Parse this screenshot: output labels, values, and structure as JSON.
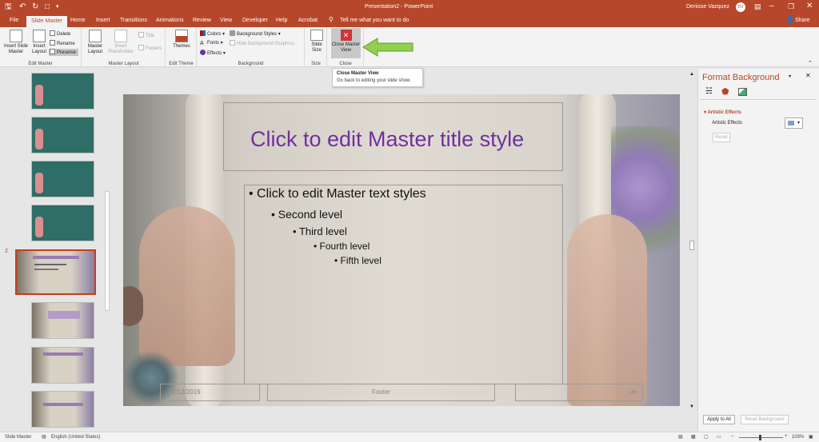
{
  "window": {
    "title": "Presentation2 - PowerPoint",
    "user": "Denisse Vazquez",
    "user_initials": "DV"
  },
  "tabs": [
    "File",
    "Slide Master",
    "Home",
    "Insert",
    "Transitions",
    "Animations",
    "Review",
    "View",
    "Developer",
    "Help",
    "Acrobat"
  ],
  "tell_me": "Tell me what you want to do",
  "share": "Share",
  "ribbon": {
    "edit_master": {
      "label": "Edit Master",
      "insert_slide_master": "Insert Slide Master",
      "insert_layout": "Insert Layout",
      "delete": "Delete",
      "rename": "Rename",
      "preserve": "Preserve"
    },
    "master_layout": {
      "label": "Master Layout",
      "master_layout": "Master Layout",
      "insert_placeholder": "Insert Placeholder",
      "title": "Title",
      "footers": "Footers"
    },
    "edit_theme": {
      "label": "Edit Theme",
      "themes": "Themes"
    },
    "background": {
      "label": "Background",
      "colors": "Colors",
      "fonts": "Fonts",
      "effects": "Effects",
      "background_styles": "Background Styles",
      "hide_bg_graphics": "Hide Background Graphics"
    },
    "size": {
      "label": "Size",
      "slide_size": "Slide Size"
    },
    "close": {
      "label": "Close",
      "close_master_view": "Close Master View"
    }
  },
  "tooltip": {
    "title": "Close Master View",
    "body": "Go back to editing your slide show."
  },
  "thumbnails": {
    "selected_number": "2"
  },
  "slide": {
    "title": "Click to edit Master title style",
    "levels": [
      "Click to edit Master text styles",
      "Second level",
      "Third level",
      "Fourth level",
      "Fifth level"
    ],
    "date": "2/12/2019",
    "footer": "Footer",
    "page": "‹#›"
  },
  "pane": {
    "title": "Format Background",
    "section": "Artistic Effects",
    "row_label": "Artistic Effects",
    "reset": "Reset",
    "apply_all": "Apply to All",
    "reset_background": "Reset Background"
  },
  "status": {
    "view": "Slide Master",
    "language": "English (United States)",
    "zoom": "103%"
  },
  "colors": {
    "accent": "#b7472a",
    "title_purple": "#7030a0",
    "arrow_green": "#92d050"
  }
}
